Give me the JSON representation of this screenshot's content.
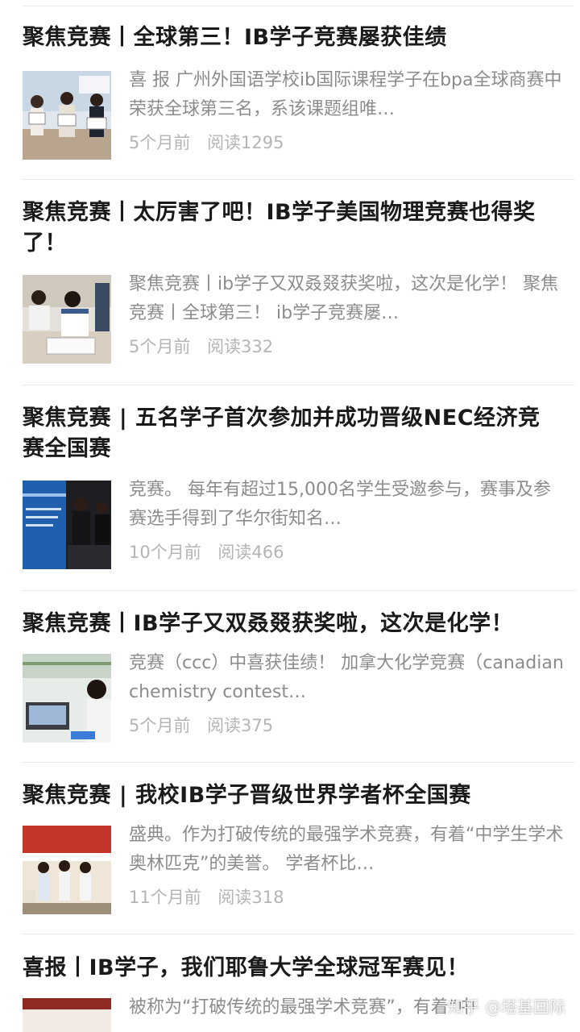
{
  "articles": [
    {
      "title": "聚焦竞赛丨全球第三！IB学子竞赛屡获佳绩",
      "summary": "喜 报 广州外国语学校ib国际课程学子在bpa全球商赛中荣获全球第三名，系该课题组唯…",
      "time": "5个月前",
      "reads": "阅读1295",
      "thumb": "students-holding-certificates-photo"
    },
    {
      "title": "聚焦竞赛丨太厉害了吧！IB学子美国物理竞赛也得奖了！",
      "summary": "聚焦竞赛丨ib学子又双叒叕获奖啦，这次是化学！ 聚焦竞赛丨全球第三！ ib学子竞赛屡…",
      "time": "5个月前",
      "reads": "阅读332",
      "thumb": "students-writing-exam-photo"
    },
    {
      "title": "聚焦竞赛 | 五名学子首次参加并成功晋级NEC经济竞赛全国赛",
      "summary": "竞赛。 每年有超过15,000名学生受邀参与，赛事及参赛选手得到了华尔街知名…",
      "time": "10个月前",
      "reads": "阅读466",
      "thumb": "economics-challenge-banner-photo"
    },
    {
      "title": "聚焦竞赛丨IB学子又双叒叕获奖啦，这次是化学！",
      "summary": "竞赛（ccc）中喜获佳绩！ 加拿大化学竞赛（canadian chemistry contest…",
      "time": "5个月前",
      "reads": "阅读375",
      "thumb": "student-at-laptop-lab-photo"
    },
    {
      "title": "聚焦竞赛 | 我校IB学子晋级世界学者杯全国赛",
      "summary": "盛典。作为打破传统的最强学术竞赛，有着“中学生学术奥林匹克”的美誉。 学者杯比…",
      "time": "11个月前",
      "reads": "阅读318",
      "thumb": "scholars-cup-team-photo"
    },
    {
      "title": "喜报丨IB学子，我们耶鲁大学全球冠军赛见！",
      "summary": "被称为“打破传统的最强学术竞赛”，有着“中",
      "time": "",
      "reads": "",
      "thumb": "yale-event-photo"
    }
  ],
  "watermark": "知乎 @塔基国际"
}
